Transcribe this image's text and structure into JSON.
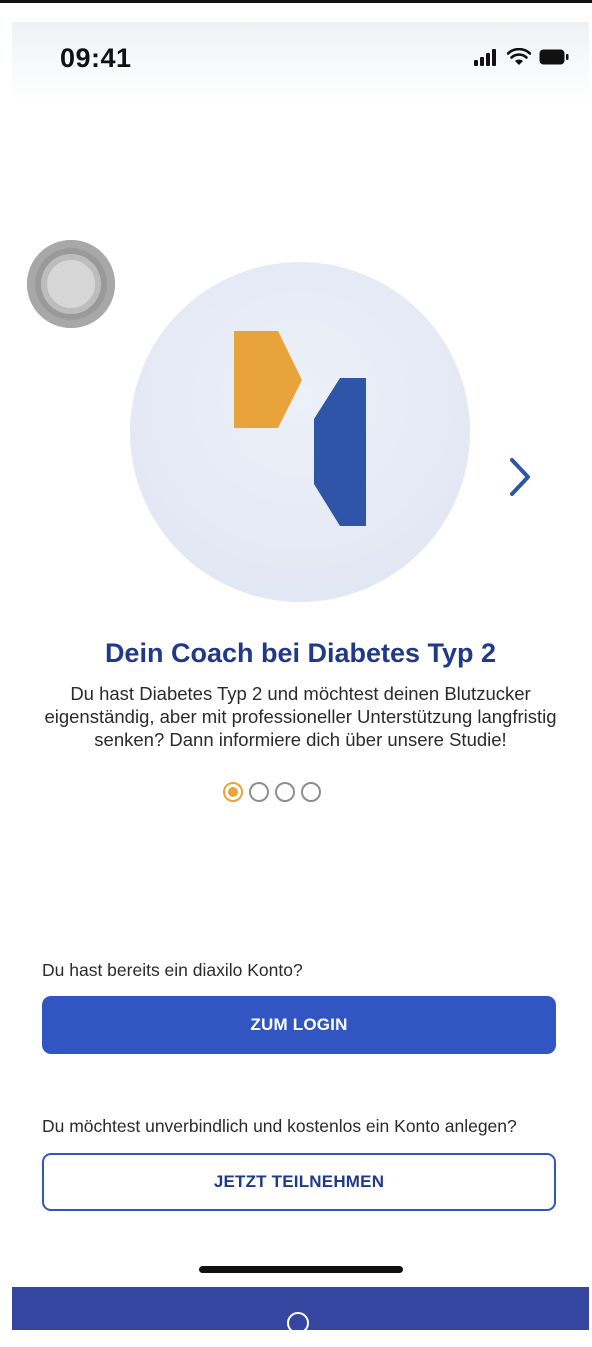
{
  "status_bar": {
    "time": "09:41",
    "icons": [
      "signal-icon",
      "wifi-icon",
      "battery-icon"
    ]
  },
  "onboarding": {
    "title": "Dein Coach bei Diabetes Typ 2",
    "description": "Du hast Diabetes Typ 2 und möchtest deinen Blutzucker eigenständig, aber mit professioneller Unterstützung langfristig senken? Dann informiere dich über unsere Studie!",
    "page_indicator": {
      "count": 4,
      "active_index": 0
    },
    "next_icon": "chevron-right-icon"
  },
  "login": {
    "prompt": "Du hast bereits ein diaxilo Konto?",
    "button_label": "ZUM LOGIN"
  },
  "signup": {
    "prompt": "Du möchtest unverbindlich und kostenlos ein Konto anlegen?",
    "button_label": "JETZT TEILNEHMEN"
  },
  "colors": {
    "primary": "#3156c1",
    "title": "#213a87",
    "accent": "#e8a33a",
    "logo_blue": "#2f55a8",
    "nav_bar": "#3446a0"
  }
}
